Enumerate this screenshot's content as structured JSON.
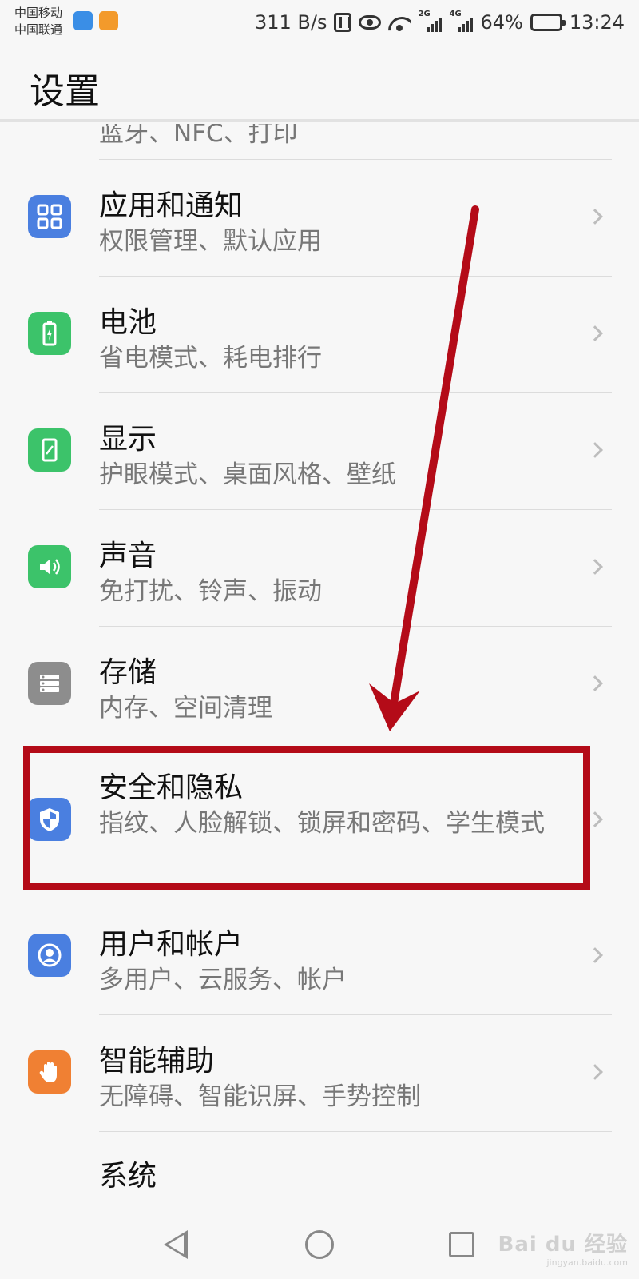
{
  "status_bar": {
    "carrier_1": "中国移动",
    "carrier_2": "中国联通",
    "speed": "311 B/s",
    "signal_1_label": "2G",
    "signal_2_label": "4G",
    "battery": "64%",
    "battery_level": 0.64,
    "time": "13:24"
  },
  "header": {
    "title": "设置"
  },
  "partial_item": {
    "subtitle": "蓝牙、NFC、打印"
  },
  "items": [
    {
      "title": "应用和通知",
      "subtitle": "权限管理、默认应用",
      "icon": "apps-icon",
      "color": "#4a7fe0"
    },
    {
      "title": "电池",
      "subtitle": "省电模式、耗电排行",
      "icon": "battery-icon",
      "color": "#3cc36a"
    },
    {
      "title": "显示",
      "subtitle": "护眼模式、桌面风格、壁纸",
      "icon": "display-icon",
      "color": "#3cc36a"
    },
    {
      "title": "声音",
      "subtitle": "免打扰、铃声、振动",
      "icon": "sound-icon",
      "color": "#3cc36a"
    },
    {
      "title": "存储",
      "subtitle": "内存、空间清理",
      "icon": "storage-icon",
      "color": "#8d8d8d"
    },
    {
      "title": "安全和隐私",
      "subtitle": "指纹、人脸解锁、锁屏和密码、学生模式",
      "icon": "shield-icon",
      "color": "#4a7fe0"
    },
    {
      "title": "用户和帐户",
      "subtitle": "多用户、云服务、帐户",
      "icon": "user-icon",
      "color": "#4a7fe0"
    },
    {
      "title": "智能辅助",
      "subtitle": "无障碍、智能识屏、手势控制",
      "icon": "hand-icon",
      "color": "#f08033"
    },
    {
      "title": "系统",
      "subtitle": "",
      "icon": "system-icon",
      "color": "#8d8d8d"
    }
  ],
  "annotation": {
    "highlight_color": "#b40b18"
  },
  "navbar": {
    "back": "back-icon",
    "home": "home-icon",
    "recent": "recent-apps-icon"
  },
  "watermark": {
    "main": "Bai du 经验",
    "sub": "jingyan.baidu.com"
  }
}
